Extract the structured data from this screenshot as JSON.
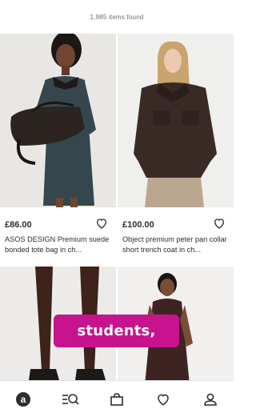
{
  "results": {
    "count_text": "1,985 items found"
  },
  "products": [
    {
      "price": "£86.00",
      "title": "ASOS DESIGN Premium suede bonded tote bag in ch..."
    },
    {
      "price": "£100.00",
      "title": "Object premium peter pan collar short trench coat in ch..."
    }
  ],
  "overlay": {
    "caption": "students,"
  },
  "bottom_nav": {
    "items": [
      {
        "icon": "asos-logo-icon"
      },
      {
        "icon": "search-menu-icon"
      },
      {
        "icon": "bag-icon"
      },
      {
        "icon": "heart-icon"
      },
      {
        "icon": "account-icon"
      }
    ]
  },
  "colors": {
    "caption_bg": "#c8138f",
    "text": "#2d2d2d"
  }
}
